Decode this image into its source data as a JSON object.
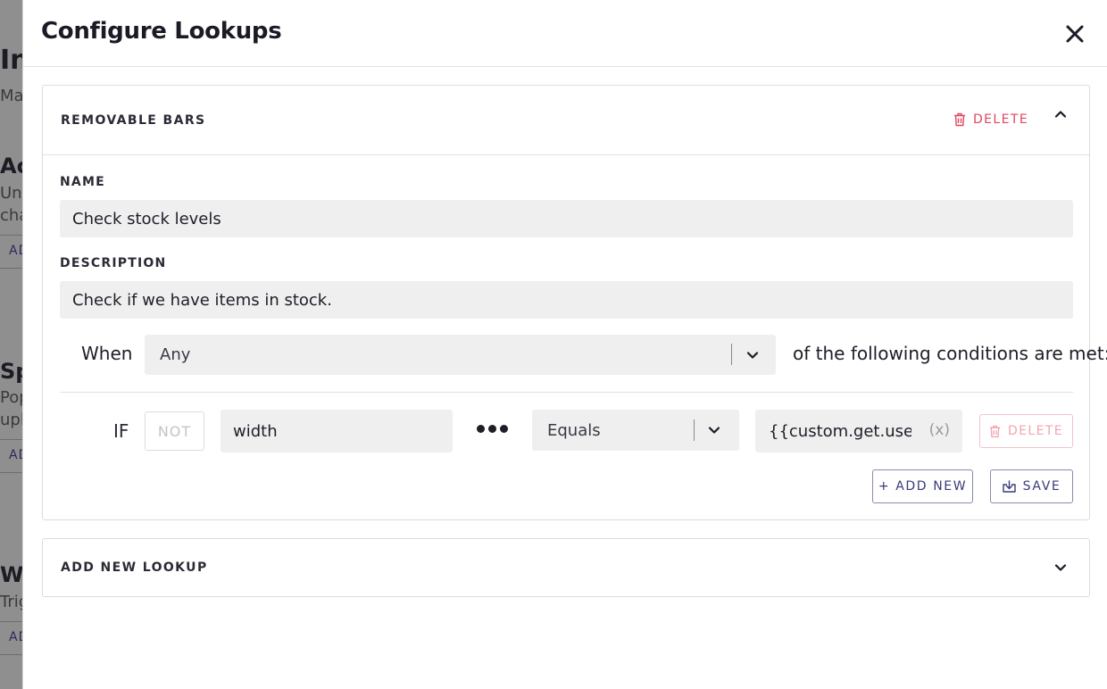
{
  "background": {
    "fragments": [
      "In",
      "Ma",
      "Ac",
      "Unl",
      "cha",
      "AD",
      "Sp",
      "Pop",
      "uplo",
      "AD",
      "We",
      "Trig",
      "AD"
    ]
  },
  "modal": {
    "title": "Configure Lookups",
    "close_icon": "close-icon"
  },
  "lookup": {
    "header_title": "REMOVABLE BARS",
    "delete_label": "DELETE",
    "name_label": "NAME",
    "name_value": "Check stock levels",
    "description_label": "DESCRIPTION",
    "description_value": "Check if we have items in stock.",
    "when_label": "When",
    "match_selected": "Any",
    "conditions_text": "of the following conditions are met:",
    "condition": {
      "if_label": "IF",
      "not_label": "NOT",
      "field_value": "width",
      "operator_selected": "Equals",
      "value": "{{custom.get.user_re",
      "var_button": "(x)",
      "delete_label": "DELETE"
    },
    "add_new_label": "+ ADD NEW",
    "save_label": "SAVE"
  },
  "add_lookup": {
    "title": "ADD NEW LOOKUP"
  },
  "colors": {
    "danger": "#e0465f",
    "accent": "#3a3a7a",
    "input_bg": "#efefef"
  }
}
